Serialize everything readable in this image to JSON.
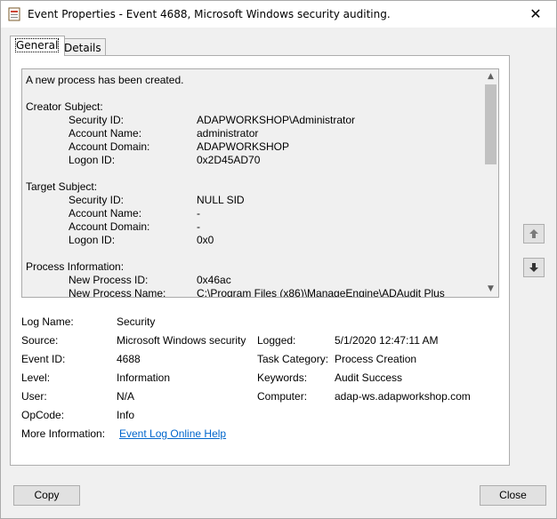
{
  "window": {
    "title": "Event Properties - Event 4688, Microsoft Windows security auditing.",
    "close_glyph": "✕"
  },
  "tabs": [
    {
      "label": "General",
      "active": true
    },
    {
      "label": "Details",
      "active": false
    }
  ],
  "description": {
    "lines": [
      {
        "text": "A new process has been created."
      },
      {
        "text": ""
      },
      {
        "text": "Creator Subject:"
      },
      {
        "key": "Security ID:",
        "value": "ADAPWORKSHOP\\Administrator"
      },
      {
        "key": "Account Name:",
        "value": "administrator"
      },
      {
        "key": "Account Domain:",
        "value": "ADAPWORKSHOP"
      },
      {
        "key": "Logon ID:",
        "value": "0x2D45AD70"
      },
      {
        "text": ""
      },
      {
        "text": "Target Subject:"
      },
      {
        "key": "Security ID:",
        "value": "NULL SID"
      },
      {
        "key": "Account Name:",
        "value": "-"
      },
      {
        "key": "Account Domain:",
        "value": "-"
      },
      {
        "key": "Logon ID:",
        "value": "0x0"
      },
      {
        "text": ""
      },
      {
        "text": "Process Information:"
      },
      {
        "key": "New Process ID:",
        "value": "0x46ac"
      },
      {
        "key": "New Process Name:",
        "value": "C:\\Program Files (x86)\\ManageEngine\\ADAudit Plus"
      }
    ]
  },
  "properties": {
    "log_name": {
      "label": "Log Name:",
      "value": "Security"
    },
    "source": {
      "label": "Source:",
      "value": "Microsoft Windows security"
    },
    "logged": {
      "label": "Logged:",
      "value": "5/1/2020 12:47:11 AM"
    },
    "event_id": {
      "label": "Event ID:",
      "value": "4688"
    },
    "task_category": {
      "label": "Task Category:",
      "value": "Process Creation"
    },
    "level": {
      "label": "Level:",
      "value": "Information"
    },
    "keywords": {
      "label": "Keywords:",
      "value": "Audit Success"
    },
    "user": {
      "label": "User:",
      "value": "N/A"
    },
    "computer": {
      "label": "Computer:",
      "value": "adap-ws.adapworkshop.com"
    },
    "opcode": {
      "label": "OpCode:",
      "value": "Info"
    },
    "more_info": {
      "label": "More Information:",
      "link": "Event Log Online Help"
    }
  },
  "buttons": {
    "copy": "Copy",
    "close": "Close"
  },
  "icons": {
    "up_arrow": "up-arrow-icon",
    "down_arrow": "down-arrow-icon"
  }
}
